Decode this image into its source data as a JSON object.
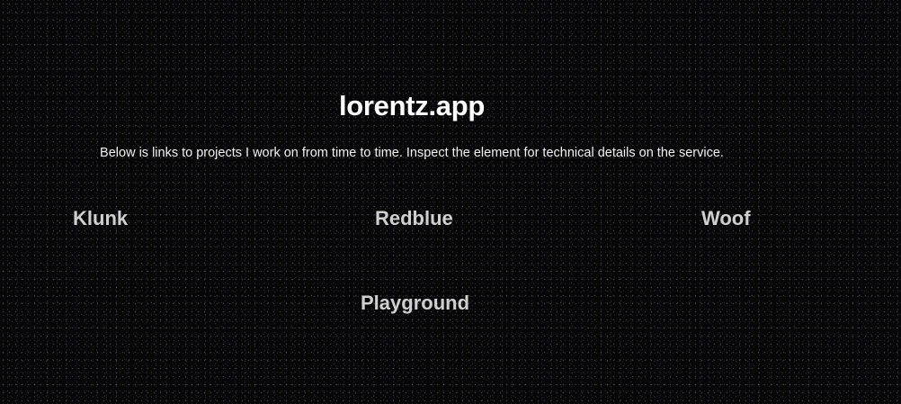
{
  "header": {
    "title": "lorentz.app",
    "intro": "Below is links to projects I work on from time to time. Inspect the element for technical details on the service."
  },
  "projects": [
    {
      "label": "Klunk"
    },
    {
      "label": "Redblue"
    },
    {
      "label": "Woof"
    },
    {
      "label": "Playground"
    }
  ],
  "colors": {
    "background": "#070707",
    "title": "#ffffff",
    "link": "#cfcfcf"
  }
}
